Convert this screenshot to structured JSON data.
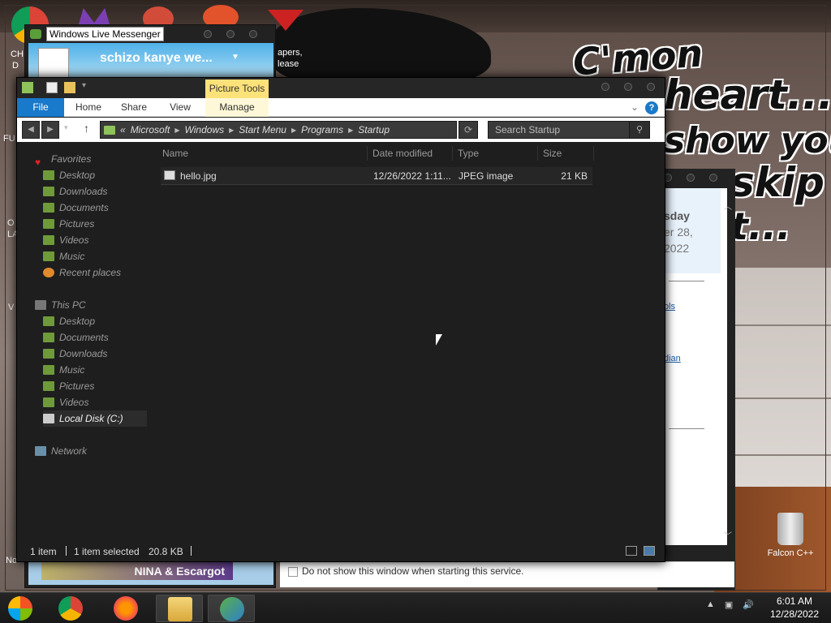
{
  "desktop": {
    "wallpaper_text": [
      "C'mon",
      "heart...",
      "show you",
      "skip",
      "t..."
    ],
    "fragments": {
      "left_ch": "CH",
      "left_d": "D",
      "left_fu": "FU",
      "left_o": "O",
      "left_la": "LA",
      "left_v": "V",
      "left_no": "No",
      "papers": "apers,",
      "please": "lease",
      "dlg_day": "sday",
      "dlg_date": "er 28,",
      "dlg_year": "2022",
      "dlg_link1": "ols",
      "dlg_link2": "dian"
    },
    "recycle_bin_label": "Falcon C++"
  },
  "messenger": {
    "title": "Windows Live Messenger",
    "display_name": "schizo kanye we...",
    "ad_text": "NINA & Escargot"
  },
  "dialog": {
    "checkbox_label": "Do not show this window when starting this service."
  },
  "explorer": {
    "contextual_tab_group": "Picture Tools",
    "ribbon_tabs": [
      "File",
      "Home",
      "Share",
      "View",
      "Manage"
    ],
    "address_overflow": "«",
    "breadcrumb": [
      "Microsoft",
      "Windows",
      "Start Menu",
      "Programs",
      "Startup"
    ],
    "search_placeholder": "Search Startup",
    "help_label": "?",
    "nav": {
      "favorites_header": "Favorites",
      "favorites": [
        "Desktop",
        "Downloads",
        "Documents",
        "Pictures",
        "Videos",
        "Music",
        "Recent places"
      ],
      "thispc_header": "This PC",
      "thispc": [
        "Desktop",
        "Documents",
        "Downloads",
        "Music",
        "Pictures",
        "Videos",
        "Local Disk (C:)"
      ],
      "network": "Network"
    },
    "columns": [
      "Name",
      "Date modified",
      "Type",
      "Size"
    ],
    "files": [
      {
        "name": "hello.jpg",
        "date": "12/26/2022 1:11...",
        "type": "JPEG image",
        "size": "21 KB"
      }
    ],
    "status": {
      "count": "1 item",
      "selected": "1 item selected",
      "size": "20.8 KB"
    }
  },
  "taskbar": {
    "time": "6:01 AM",
    "date": "12/28/2022"
  }
}
